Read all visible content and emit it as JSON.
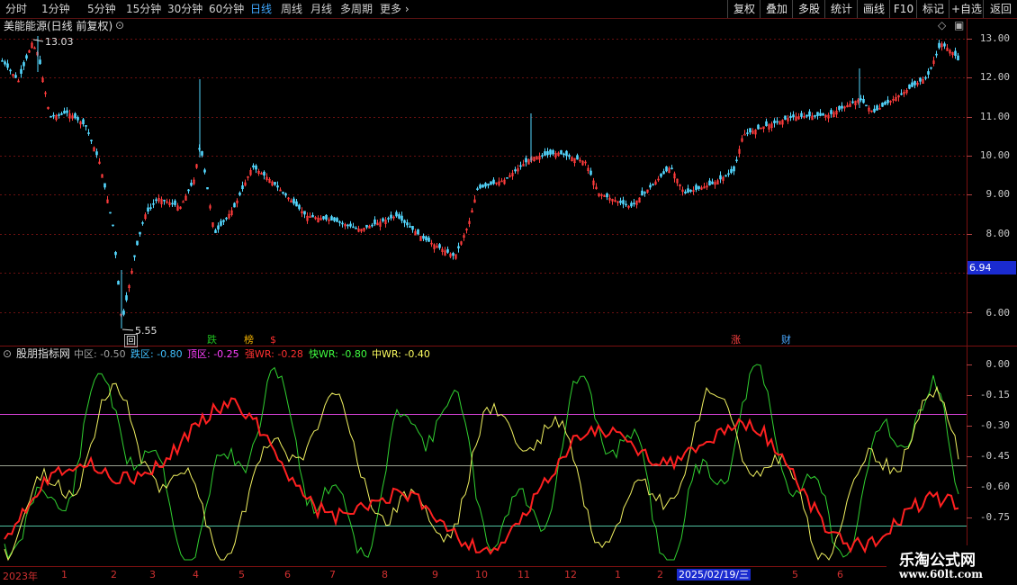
{
  "toolbar": {
    "periods": [
      "分时",
      "1分钟",
      "5分钟",
      "15分钟",
      "30分钟",
      "60分钟",
      "日线",
      "周线",
      "月线",
      "多周期",
      "更多"
    ],
    "active_period": "日线",
    "right_buttons": [
      "复权",
      "叠加",
      "多股",
      "统计",
      "画线",
      "F10",
      "标记",
      "+自选",
      "返回"
    ]
  },
  "stock": {
    "title": "美能能源(日线 前复权)",
    "high_label": "13.03",
    "low_label": "5.55",
    "current_price": "6.94",
    "price_axis": [
      "13.00",
      "12.00",
      "11.00",
      "10.00",
      "9.00",
      "8.00",
      "6.00"
    ],
    "event_tags": [
      {
        "text": "回",
        "color": "#e8e8e8"
      },
      {
        "text": "跌",
        "color": "#20c020"
      },
      {
        "text": "榜",
        "color": "#f0b000"
      },
      {
        "text": "$",
        "color": "#ff3030"
      },
      {
        "text": "涨",
        "color": "#ff4040"
      },
      {
        "text": "财",
        "color": "#4aa8ff"
      }
    ]
  },
  "indicator": {
    "name": "股朋指标网",
    "params": [
      {
        "label": "中区: -0.50",
        "color": "#a0a0a0"
      },
      {
        "label": "跌区: -0.80",
        "color": "#40c0ff"
      },
      {
        "label": "顶区: -0.25",
        "color": "#ff40ff"
      },
      {
        "label": "强WR: -0.28",
        "color": "#ff3030"
      },
      {
        "label": "快WR: -0.80",
        "color": "#40ff40"
      },
      {
        "label": "中WR: -0.40",
        "color": "#ffff60"
      }
    ],
    "axis": [
      "0.00",
      "-0.15",
      "-0.30",
      "-0.45",
      "-0.60",
      "-0.75"
    ]
  },
  "timeline": {
    "year_label": "2023年",
    "months": [
      "1",
      "2",
      "3",
      "4",
      "5",
      "6",
      "7",
      "8",
      "9",
      "10",
      "11",
      "12",
      "1",
      "2",
      "5",
      "6"
    ],
    "cursor_date": "2025/02/19/三"
  },
  "watermark": {
    "title": "乐淘公式网",
    "url": "www.60lt.com"
  },
  "colors": {
    "up": "#ff3c3c",
    "down": "#54d8ff",
    "grid": "#6a1010"
  }
}
